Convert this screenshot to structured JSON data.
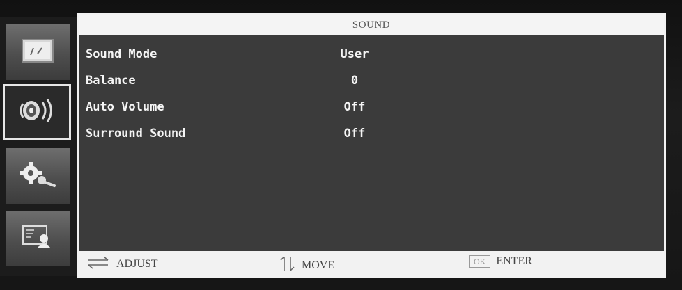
{
  "sidebar": {
    "tabs": [
      {
        "name": "picture",
        "icon": "picture-icon"
      },
      {
        "name": "sound",
        "icon": "speaker-icon",
        "active": true
      },
      {
        "name": "setup",
        "icon": "gears-wrench-icon"
      },
      {
        "name": "app",
        "icon": "screen-person-icon"
      }
    ]
  },
  "menu": {
    "title": "SOUND",
    "items": [
      {
        "label": "Sound Mode",
        "value": "User"
      },
      {
        "label": "Balance",
        "value": "0"
      },
      {
        "label": "Auto Volume",
        "value": "Off"
      },
      {
        "label": "Surround Sound",
        "value": "Off"
      }
    ]
  },
  "footer": {
    "adjust_label": "ADJUST",
    "move_label": "MOVE",
    "ok_label": "OK",
    "enter_label": "ENTER"
  },
  "colors": {
    "panel_bg": "#3b3b3b",
    "header_bg": "#f4f4f4",
    "tab_bg": "#5a5a5a"
  }
}
